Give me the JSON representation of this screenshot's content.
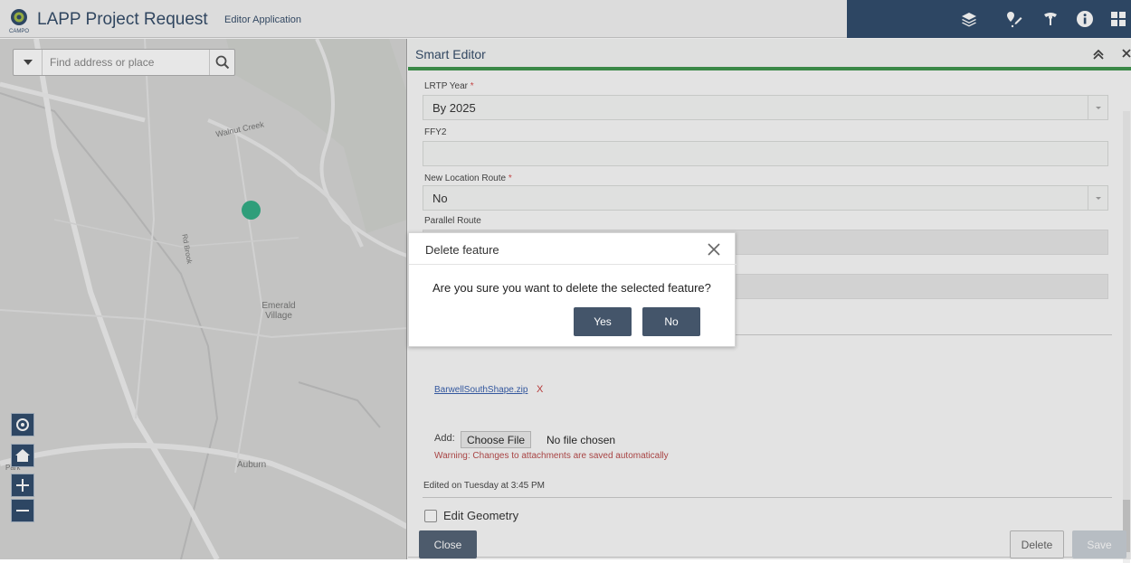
{
  "header": {
    "title": "LAPP Project Request",
    "subtitle": "Editor Application",
    "logo_text": "CAMPO",
    "tools": [
      "layers-icon",
      "edit-location-icon",
      "sketch-icon",
      "info-icon",
      "widgets-grid-icon"
    ]
  },
  "map": {
    "search": {
      "placeholder": "Find address or place"
    },
    "labels": {
      "creek": "Walnut Creek",
      "road": "Rd Brook",
      "village": "Emerald\nVillage",
      "auburn": "Auburn",
      "park": "Park"
    },
    "controls": [
      "locate-icon",
      "home-icon",
      "zoom-in-icon",
      "zoom-out-icon"
    ],
    "colors": {
      "feature_point": "#1fa77b",
      "map_base": "#d2d3d1"
    }
  },
  "panel": {
    "title": "Smart Editor",
    "accent_color": "#2d8c3c",
    "fields": {
      "lrtp_year": {
        "label": "LRTP Year",
        "required": "*",
        "value": "By 2025"
      },
      "ffy2": {
        "label": "FFY2",
        "value": ""
      },
      "new_location_route": {
        "label": "New Location Route",
        "required": "*",
        "value": "No"
      },
      "parallel_route": {
        "label": "Parallel Route",
        "value": ""
      }
    },
    "attachments": {
      "file_name": "BarwellSouthShape.zip",
      "remove_glyph": "X",
      "add_label": "Add:",
      "choose_button": "Choose File",
      "file_status": "No file chosen",
      "warning": "Warning: Changes to attachments are saved automatically"
    },
    "edited_on": "Edited on Tuesday at 3:45 PM",
    "edit_geometry_label": "Edit Geometry",
    "edit_geometry_checked": false,
    "buttons": {
      "close": "Close",
      "delete": "Delete",
      "save": "Save"
    }
  },
  "dialog": {
    "title": "Delete feature",
    "message": "Are you sure you want to delete the selected feature?",
    "yes": "Yes",
    "no": "No"
  }
}
